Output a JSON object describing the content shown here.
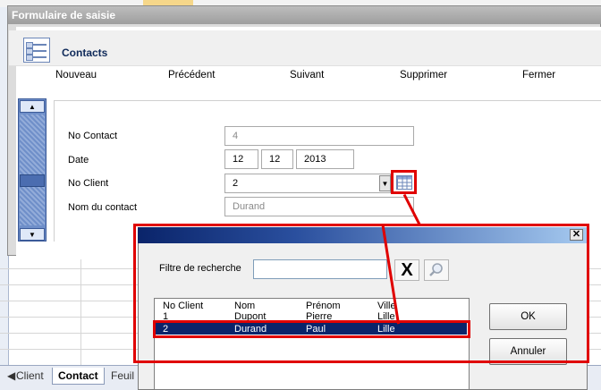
{
  "window": {
    "title": "Formulaire de saisie"
  },
  "header": {
    "title": "Contacts"
  },
  "toolbar": {
    "new_label": "Nouveau",
    "prev_label": "Précédent",
    "next_label": "Suivant",
    "delete_label": "Supprimer",
    "close_label": "Fermer"
  },
  "form": {
    "contact_no": {
      "label": "No Contact",
      "value": "4"
    },
    "date": {
      "label": "Date",
      "day": "12",
      "month": "12",
      "year": "2013"
    },
    "client_no": {
      "label": "No Client",
      "value": "2"
    },
    "contact_name": {
      "label": "Nom du contact",
      "value": "Durand"
    }
  },
  "search_dialog": {
    "filter_label": "Filtre de recherche",
    "filter_value": "",
    "clear_label": "X",
    "columns": [
      "No Client",
      "Nom",
      "Prénom",
      "Ville"
    ],
    "rows": [
      {
        "no": "1",
        "nom": "Dupont",
        "prenom": "Pierre",
        "ville": "Lille"
      },
      {
        "no": "2",
        "nom": "Durand",
        "prenom": "Paul",
        "ville": "Lille"
      }
    ],
    "selected_row": 1,
    "ok_label": "OK",
    "cancel_label": "Annuler"
  },
  "sheet_tabs": {
    "tab1": "Client",
    "tab2": "Contact",
    "tab3": "Feuil",
    "active": "Contact"
  },
  "colors": {
    "highlight": "#e00000",
    "selection": "#0a246a",
    "scroll_accent": "#6f8fc9"
  }
}
